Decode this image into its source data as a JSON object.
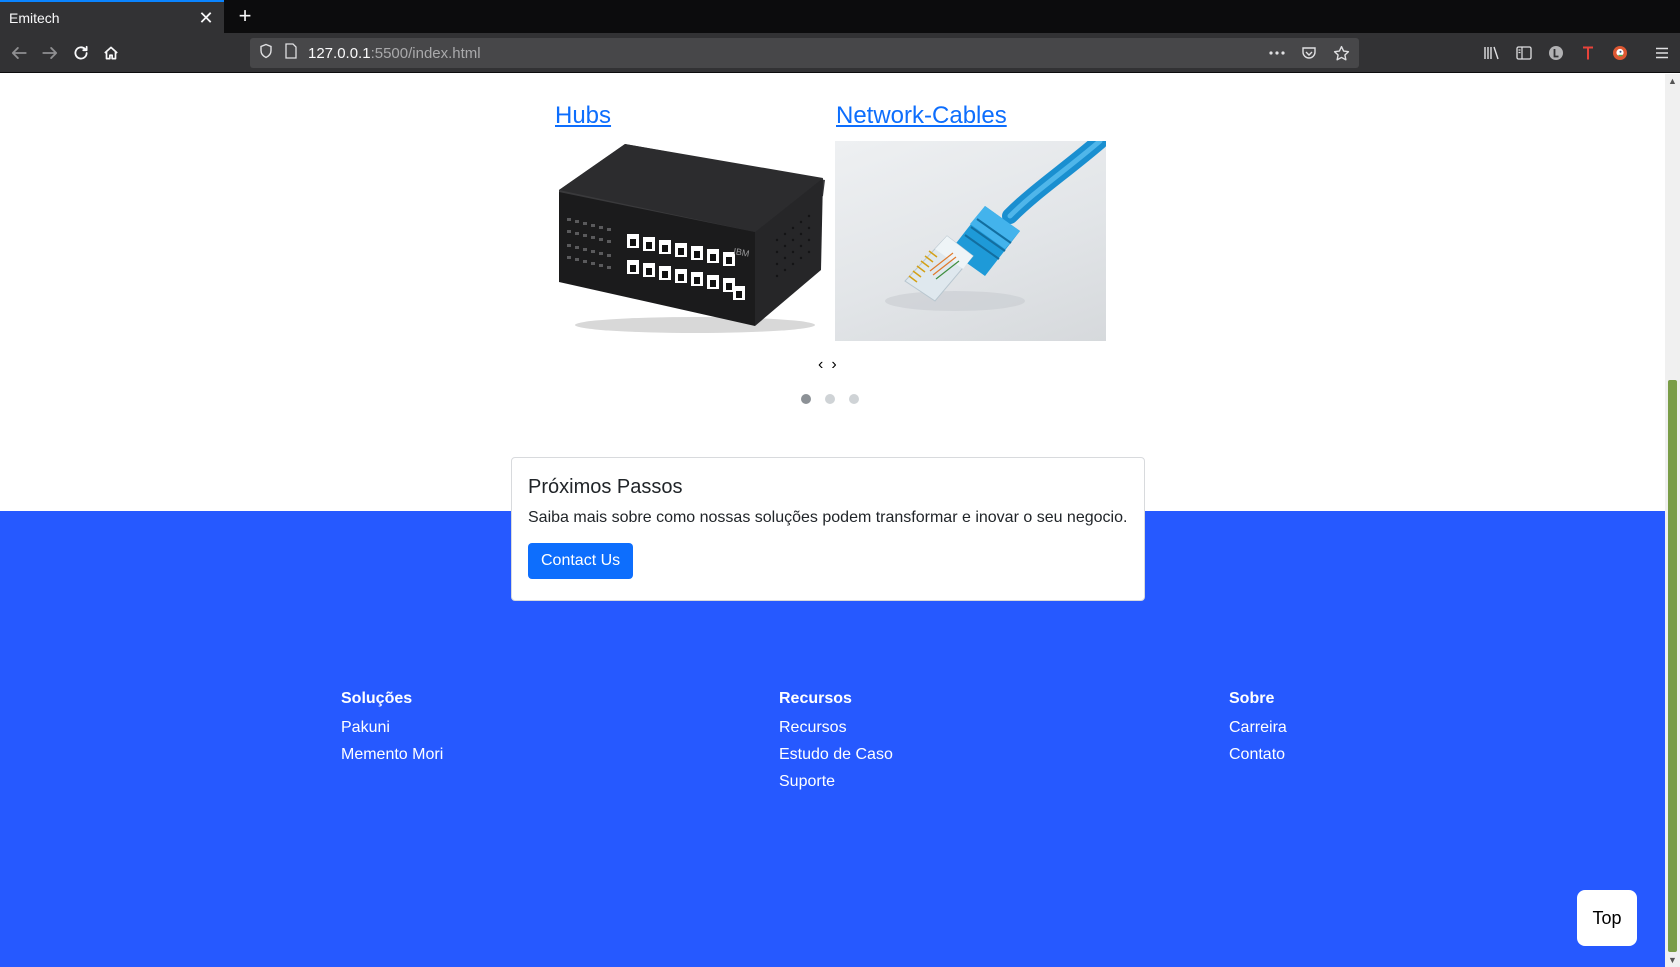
{
  "browser": {
    "tab_title": "Emitech",
    "tab_close": "✕",
    "new_tab": "+",
    "url_host": "127.0.0.1",
    "url_rest": ":5500/index.html"
  },
  "carousel": {
    "items": [
      {
        "title": "Hubs",
        "image": "network-switch-image"
      },
      {
        "title": "Network-Cables",
        "image": "ethernet-cable-image"
      }
    ],
    "prev": "‹",
    "next": "›",
    "indicator_count": 3,
    "active_indicator": 0
  },
  "card": {
    "title": "Próximos Passos",
    "text": "Saiba mais sobre como nossas soluções podem transformar e inovar o seu negocio.",
    "button": "Contact Us"
  },
  "footer": {
    "columns": [
      {
        "heading": "Soluções",
        "links": [
          "Pakuni",
          "Memento Mori"
        ]
      },
      {
        "heading": "Recursos",
        "links": [
          "Recursos",
          "Estudo de Caso",
          "Suporte"
        ]
      },
      {
        "heading": "Sobre",
        "links": [
          "Carreira",
          "Contato"
        ]
      }
    ]
  },
  "top_button": "Top",
  "colors": {
    "footer_bg": "#2659ff",
    "primary": "#0d6efd",
    "scroll_thumb": "#7a9d47"
  }
}
